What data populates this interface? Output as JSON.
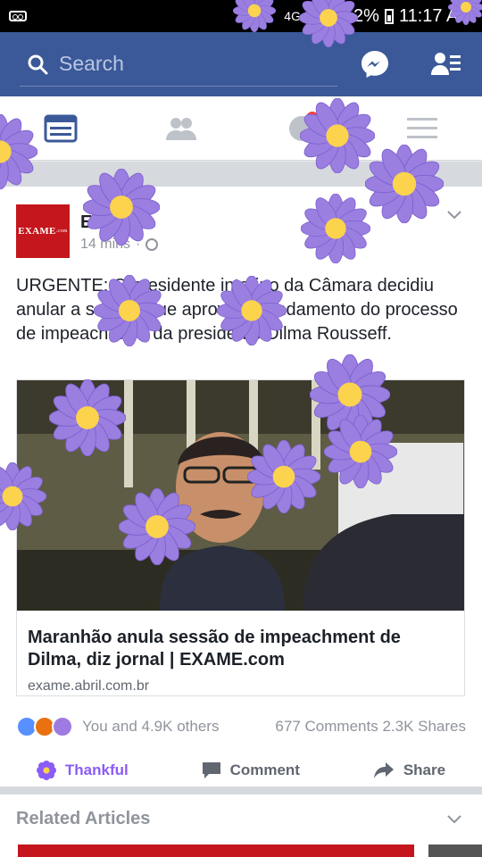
{
  "status_bar": {
    "battery": "52%",
    "time": "11:17 AM",
    "network": "4G"
  },
  "search": {
    "placeholder": "Search"
  },
  "post": {
    "logo_text": "EXAME",
    "logo_suffix": ".com",
    "author": "Exame",
    "timestamp": "14 mins",
    "text": "URGENTE: O presidente interino da Câmara decidiu anular a sessão que aprovou o andamento do processo de impeachment da presidente Dilma Rousseff.",
    "link_title": "Maranhão anula sessão de impeachment de Dilma, diz jornal | EXAME.com",
    "link_domain": "exame.abril.com.br",
    "reactions_text": "You and 4.9K others",
    "comments": "677 Comments",
    "shares": "2.3K Shares",
    "actions": {
      "thankful": "Thankful",
      "comment": "Comment",
      "share": "Share"
    }
  },
  "related": {
    "title": "Related Articles"
  },
  "colors": {
    "header": "#3b5998",
    "thankful": "#8b5cf6",
    "flower_petal": "#9a7fe0",
    "flower_center": "#fcd34d"
  }
}
